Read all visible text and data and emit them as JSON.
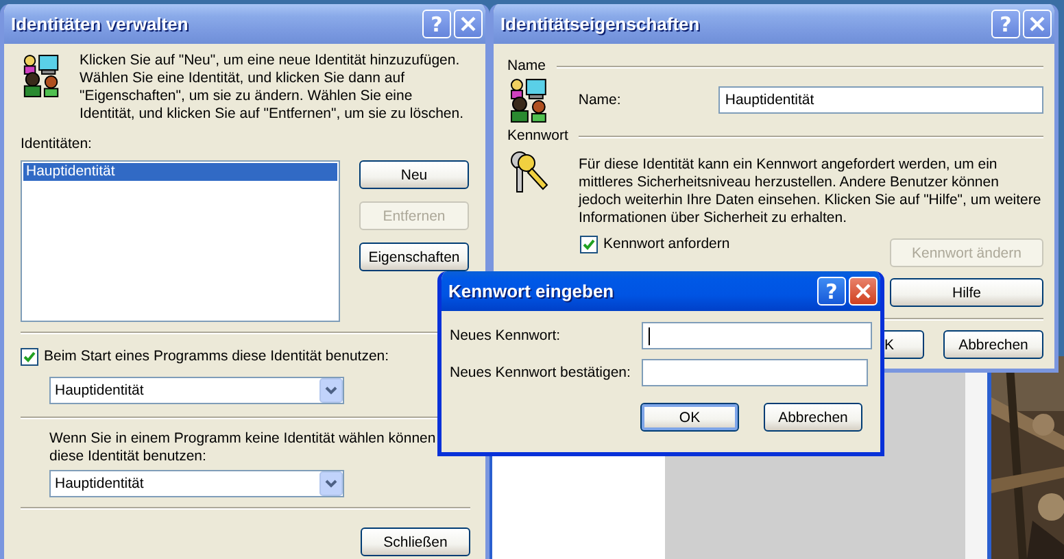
{
  "identities_window": {
    "title": "Identitäten verwalten",
    "active": false,
    "help": "?",
    "intro": "Klicken Sie auf \"Neu\", um eine neue Identität hinzuzufügen. Wählen Sie eine Identität, und klicken Sie dann auf \"Eigenschaften\", um sie zu ändern. Wählen Sie eine Identität, und klicken Sie auf \"Entfernen\", um sie zu löschen.",
    "list_label": "Identitäten:",
    "identities": [
      {
        "label": "Hauptidentität",
        "selected": true
      }
    ],
    "buttons": [
      {
        "label": "Neu",
        "disabled": false
      },
      {
        "label": "Entfernen",
        "disabled": true
      },
      {
        "label": "Eigenschaften",
        "disabled": false
      }
    ],
    "startup": {
      "label": "Beim Start eines Programms diese Identität benutzen:",
      "checked": true,
      "value": "Hauptidentität"
    },
    "fallback": {
      "label": "Wenn Sie in einem Programm keine Identität wählen können\ndiese Identität benutzen:",
      "value": "Hauptidentität"
    },
    "close_button": "Schließen"
  },
  "properties_window": {
    "title": "Identitätseigenschaften",
    "active": false,
    "help": "?",
    "name_group": "Name",
    "name_label": "Name:",
    "name_value": "Hauptidentität",
    "password_group": "Kennwort",
    "description": "Für diese Identität kann ein Kennwort angefordert werden, um ein mittleres Sicherheitsniveau herzustellen. Andere Benutzer können jedoch weiterhin Ihre Daten einsehen. Klicken Sie auf \"Hilfe\", um weitere Informationen über Sicherheit zu erhalten.",
    "require_password": {
      "label": "Kennwort anfordern",
      "checked": true
    },
    "buttons": [
      {
        "label": "Kennwort ändern",
        "disabled": true
      },
      {
        "label": "Hilfe",
        "disabled": false
      }
    ],
    "footer_buttons": [
      "K",
      "Abbrechen"
    ]
  },
  "password_dialog": {
    "title": "Kennwort eingeben",
    "active": true,
    "help": "?",
    "fields": [
      {
        "label": "Neues Kennwort:",
        "focused": true
      },
      {
        "label": "Neues Kennwort bestätigen:",
        "focused": false
      }
    ],
    "buttons": [
      {
        "label": "OK",
        "default": true
      },
      {
        "label": "Abbrechen",
        "default": false
      }
    ]
  }
}
